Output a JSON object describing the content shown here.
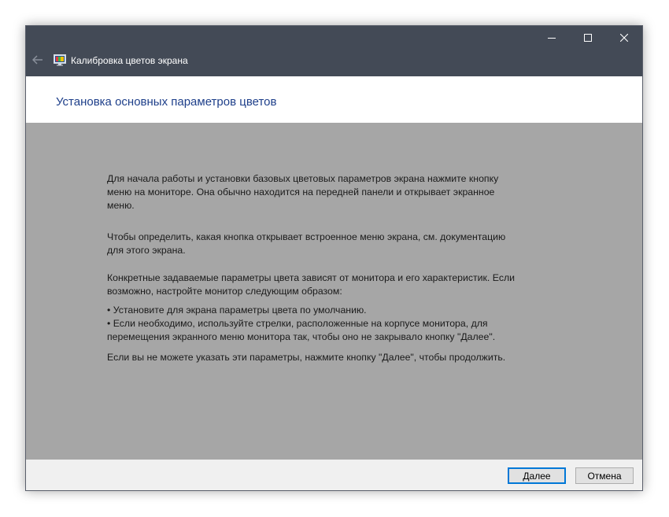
{
  "window": {
    "title": "Калибровка цветов экрана",
    "icons": {
      "back": "back-arrow-icon",
      "app": "display-color-calibration-icon",
      "minimize": "minimize-icon",
      "maximize": "maximize-icon",
      "close": "close-icon"
    }
  },
  "header": {
    "title": "Установка основных параметров цветов"
  },
  "content": {
    "paragraph1_lines": [
      "Для начала работы и установки базовых цветовых параметров экрана нажмите кнопку",
      "меню на мониторе. Она обычно находится на передней панели и открывает экранное",
      "меню."
    ],
    "paragraph2_lines": [
      "Чтобы определить, какая кнопка открывает встроенное меню экрана, см. документацию",
      "для этого экрана."
    ],
    "paragraph3_lines": [
      "Конкретные задаваемые параметры цвета зависят от монитора и его характеристик. Если",
      "возможно, настройте монитор следующим образом:"
    ],
    "bullet1": "• Установите для экрана параметры цвета по умолчанию.",
    "bullet2_lines": [
      "• Если необходимо, используйте стрелки, расположенные на корпусе монитора, для",
      "перемещения экранного меню монитора так, чтобы оно не закрывало кнопку \"Далее\"."
    ],
    "paragraph4": "Если вы не можете указать эти параметры, нажмите кнопку \"Далее\", чтобы продолжить."
  },
  "footer": {
    "next_label": "Далее",
    "cancel_label": "Отмена"
  },
  "colors": {
    "titlebar": "#434a56",
    "header_title": "#1e3f8a",
    "content_bg": "#a6a6a6",
    "accent": "#0078d7"
  }
}
